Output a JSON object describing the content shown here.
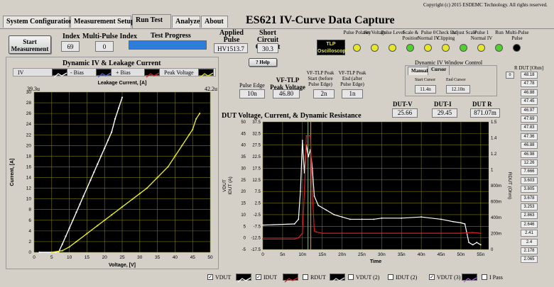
{
  "tabs": [
    "System Configuration",
    "Measurement Setup",
    "Run Test",
    "Analyze",
    "About"
  ],
  "title": "ES621 IV-Curve Data Capture",
  "copyright": "Copyright (c) 2015 ESDEMC Technology. All rights reserved.",
  "start_button": "Start Measurement",
  "index": {
    "label": "Index",
    "value": "69"
  },
  "multi_pulse_index": {
    "label": "Multi-Pulse Index",
    "value": "0"
  },
  "progress": {
    "label": "Test Progress",
    "fraction": 1.0
  },
  "applied_pulse": {
    "label": "Applied Pulse Voltage",
    "value": "HV1513.7"
  },
  "short_circuit": {
    "label": "Short Circuit Current",
    "value": "30.3"
  },
  "tlp_badge": "TLP Oscilloscope",
  "indicators": [
    {
      "label": "Pulse Polarity",
      "color": "#e6e62a"
    },
    {
      "label": "Set Voltage",
      "color": "#e6e62a"
    },
    {
      "label": "Pulse Level",
      "color": "#e6e62a"
    },
    {
      "label": "Scale & Position",
      "color": "#4fd02a"
    },
    {
      "label": "Pulse 0 Normal IV",
      "color": "#e6e62a"
    },
    {
      "label": "Check for Clipping",
      "color": "#e6e62a"
    },
    {
      "label": "Adjust Scale",
      "color": "#4fd02a"
    },
    {
      "label": "Pulse 1 Normal IV",
      "color": "#e6e62a"
    },
    {
      "label": "Run",
      "color": "#4fd02a"
    },
    {
      "label": "Multi-Pulse Pulse",
      "color": "#000000"
    }
  ],
  "iv_panel": {
    "title": "Dynamic IV & Leakage Current",
    "legend": [
      "IV",
      "- Bias",
      "+ Bias",
      "Peak Voltage"
    ],
    "corner_left": "39.3u",
    "corner_right": "42.2u"
  },
  "help_label": "Help",
  "pulse_edge": {
    "label": "Pulse Edge",
    "value": "10n"
  },
  "vf_tlp_peak": {
    "label": "VF-TLP Peak Voltage",
    "value": "46.80"
  },
  "peak_start": {
    "label": "VF-TLP Peak Start (before Pulse Edge)",
    "value": "2n"
  },
  "peak_end": {
    "label": "VF-TLP Peak End (after Pulse Edge)",
    "value": "1n"
  },
  "window_control": {
    "title": "Dynamic IV Window Control",
    "tabs": [
      "Manual",
      "Cursor"
    ],
    "start_cursor": {
      "label": "Start Cursor",
      "value": "11.4n"
    },
    "end_cursor": {
      "label": "End Cursor",
      "value": "12.10n"
    }
  },
  "readouts": [
    {
      "label": "DUT-V",
      "value": "25.66"
    },
    {
      "label": "DUT-I",
      "value": "29.45"
    },
    {
      "label": "DUT R",
      "value": "871.07m"
    }
  ],
  "rdut": {
    "label": "R DUT [Ohm]",
    "index": "0",
    "values": [
      "48.18",
      "47.78",
      "46.88",
      "47.45",
      "46.97",
      "47.69",
      "47.83",
      "47.36",
      "46.88",
      "46.98",
      "12.26",
      "7.666",
      "3.603",
      "3.805",
      "3.678",
      "3.253",
      "2.863",
      "2.646",
      "2.41",
      "2.4",
      "2.178",
      "2.065"
    ]
  },
  "chart_data": [
    {
      "type": "scatter",
      "title": "Leakage Current, [A]",
      "xlabel": "Voltage, [V]",
      "ylabel": "Current, [A]",
      "xlim": [
        0,
        50
      ],
      "ylim": [
        0,
        30
      ],
      "xticks": [
        0,
        5,
        10,
        15,
        20,
        25,
        30,
        35,
        40,
        45,
        50
      ],
      "yticks": [
        0,
        2,
        4,
        6,
        8,
        10,
        12,
        14,
        16,
        18,
        20,
        22,
        24,
        26,
        28,
        30
      ],
      "grid": true,
      "series": [
        {
          "name": "IV",
          "color": "#ffffff",
          "x": [
            1.5,
            6,
            7,
            8,
            9,
            10,
            11,
            12,
            13,
            14,
            15,
            16,
            17,
            18,
            19,
            20,
            21,
            22,
            23,
            24,
            25
          ],
          "y": [
            0,
            0,
            0.1,
            1.5,
            3,
            4.5,
            6,
            7.5,
            9,
            10.5,
            12,
            13.5,
            15,
            16.5,
            18,
            19.5,
            21,
            22.5,
            25,
            27,
            29
          ]
        },
        {
          "name": "Peak Voltage",
          "color": "#e6e62a",
          "x": [
            5,
            8,
            10,
            12,
            15,
            18,
            20,
            22,
            25,
            28,
            30,
            32,
            35,
            38,
            40,
            42,
            44,
            45,
            46,
            47
          ],
          "y": [
            0,
            0.3,
            1,
            2,
            3.5,
            5,
            6,
            7,
            8.5,
            10,
            11,
            12,
            14,
            16,
            18,
            20,
            22,
            23,
            25,
            26
          ]
        }
      ]
    },
    {
      "type": "line",
      "title": "DUT Voltage, Current, & Dynamic Resistance",
      "xlabel": "Time",
      "ylabel": "VDUT",
      "y2label": "IDUT (A)",
      "y3label": "RDUT (Ohm)",
      "xticks": [
        "0",
        "5n",
        "10n",
        "15n",
        "20n",
        "25n",
        "30n",
        "35n",
        "40n",
        "45n",
        "50n",
        "55n"
      ],
      "xlim": [
        0,
        57
      ],
      "ylim": [
        -5,
        50
      ],
      "yticks": [
        "50",
        "45",
        "40",
        "35",
        "30",
        "25",
        "20",
        "15",
        "10",
        "5",
        "0",
        "-5"
      ],
      "y2ticks": [
        "37.5",
        "32.5",
        "27.5",
        "22.5",
        "17.5",
        "12.5",
        "7.5",
        "2.5",
        "-2.5",
        "-7.5",
        "-12.5",
        "-17.5"
      ],
      "y3ticks": [
        "1.5",
        "1.4",
        "1.2",
        "1",
        "800m",
        "600m",
        "400m",
        "200m",
        "0"
      ],
      "grid": true,
      "series": [
        {
          "name": "VDUT",
          "color": "#ffffff",
          "x": [
            0,
            8,
            9,
            9.5,
            10,
            10.5,
            11,
            11.5,
            12,
            12.5,
            13,
            14,
            16,
            18,
            20,
            22,
            25,
            28,
            30,
            35,
            40,
            45,
            48,
            50,
            51,
            52,
            53,
            54,
            55
          ],
          "y": [
            5.5,
            6,
            8,
            20,
            42,
            28,
            40,
            35,
            38,
            30,
            18,
            14,
            12,
            10,
            9,
            8,
            8,
            8,
            8.5,
            8.5,
            9,
            8,
            7,
            6.5,
            6,
            -2,
            -3,
            -2,
            -3
          ]
        },
        {
          "name": "IDUT",
          "color": "#d42020",
          "x": [
            0,
            8,
            9,
            9.5,
            10,
            10.5,
            11,
            11.5,
            12,
            12.5,
            13,
            13.5,
            15,
            20,
            25,
            30,
            40,
            50,
            53,
            55
          ],
          "y": [
            -0.5,
            -0.5,
            0,
            1,
            2,
            20,
            44,
            44,
            44,
            20,
            3,
            2.5,
            2,
            2,
            2,
            2,
            2,
            2,
            2.3,
            2
          ]
        }
      ]
    }
  ],
  "bottom_legend": [
    "VDUT",
    "IDUT",
    "RDUT",
    "VDUT (2)",
    "IDUT (2)",
    "VDUT (3)",
    "I Pass"
  ]
}
